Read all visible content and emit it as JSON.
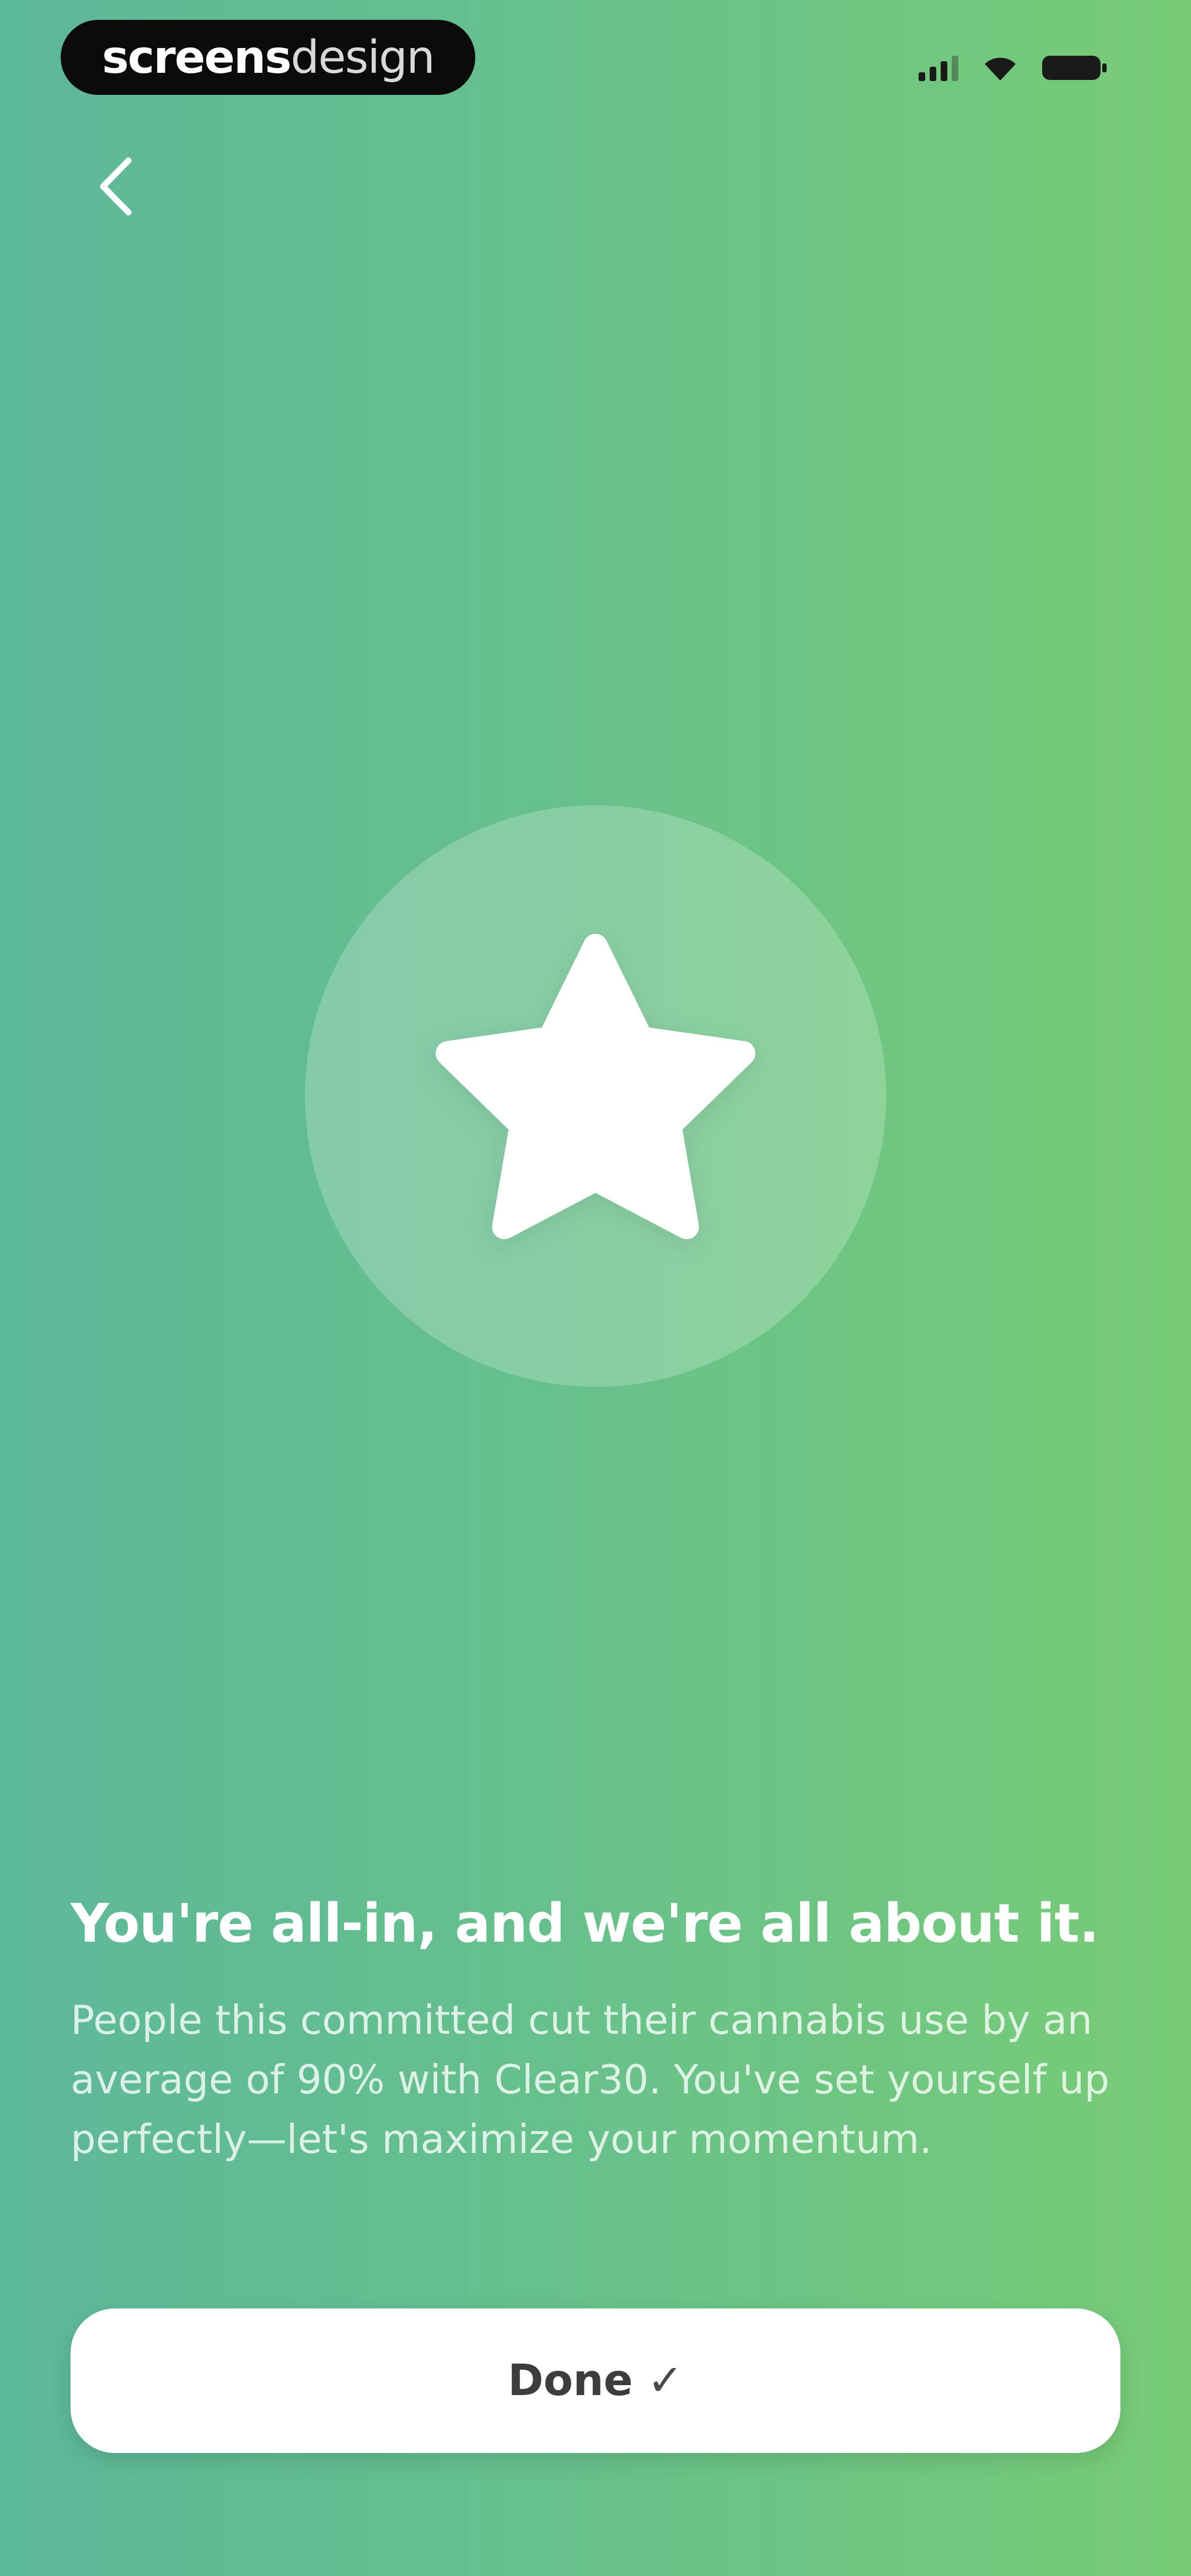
{
  "status_bar": {
    "brand_bold": "screens",
    "brand_light": "design",
    "icons": [
      "signal-icon",
      "wifi-icon",
      "battery-icon"
    ]
  },
  "navigation": {
    "back_icon": "chevron-left-icon"
  },
  "badge": {
    "icon": "star-icon"
  },
  "message": {
    "headline": "You're all-in, and we're all about it.",
    "body": "People this committed cut their cannabis use by an average of 90% with Clear30. You've set yourself up perfectly—let's maximize your momentum."
  },
  "done_button": {
    "label": "Done",
    "check": "✓"
  },
  "colors": {
    "gradient_start": "#5cb89a",
    "gradient_end": "#78cc76",
    "button_background": "#ffffff",
    "text_primary": "#ffffff"
  }
}
